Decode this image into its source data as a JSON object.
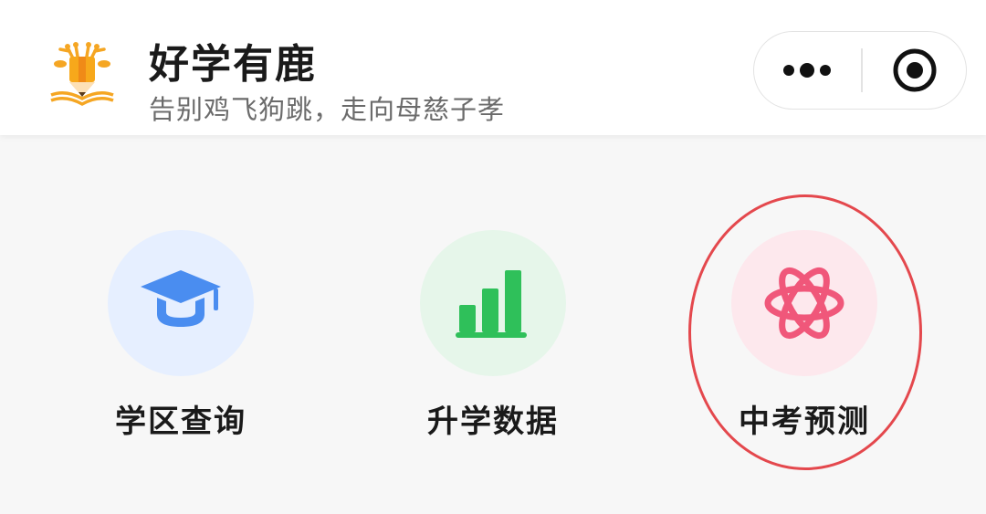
{
  "header": {
    "title": "好学有鹿",
    "subtitle": "告别鸡飞狗跳，走向母慈子孝",
    "logo_icon": "deer-pencil-book-logo",
    "menu_icon": "more-dots-icon",
    "close_icon": "target-circle-icon"
  },
  "menu": {
    "items": [
      {
        "label": "学区查询",
        "icon": "graduation-cap-icon",
        "bg_color": "#e6efff",
        "icon_color": "#4a8df0"
      },
      {
        "label": "升学数据",
        "icon": "bar-chart-icon",
        "bg_color": "#e6f6ea",
        "icon_color": "#2fc05a"
      },
      {
        "label": "中考预测",
        "icon": "atom-icon",
        "bg_color": "#fde8ed",
        "icon_color": "#f0577a"
      }
    ]
  },
  "annotation": {
    "color": "#e4484d",
    "target": "中考预测"
  }
}
